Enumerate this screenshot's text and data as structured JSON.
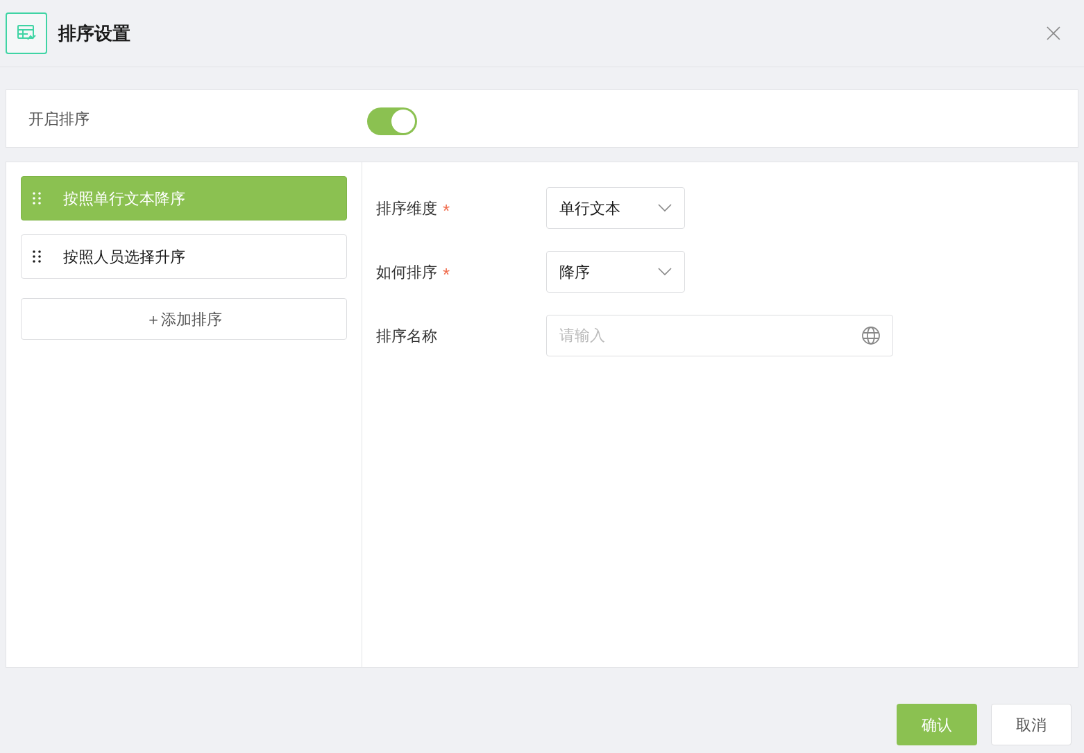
{
  "dialog": {
    "title": "排序设置"
  },
  "enable_sort": {
    "label": "开启排序",
    "on": true
  },
  "sort_rules": [
    {
      "label": "按照单行文本降序",
      "selected": true
    },
    {
      "label": "按照人员选择升序",
      "selected": false
    }
  ],
  "add_button": {
    "icon": "＋",
    "label": "添加排序"
  },
  "form": [
    {
      "kind": "select",
      "label": "排序维度",
      "required": true,
      "value": "单行文本"
    },
    {
      "kind": "select",
      "label": "如何排序",
      "required": true,
      "value": "降序"
    },
    {
      "kind": "input",
      "label": "排序名称",
      "required": false,
      "placeholder": "请输入"
    }
  ],
  "required_mark": "*",
  "buttons": [
    {
      "label": "确认",
      "primary": true
    },
    {
      "label": "取消",
      "primary": false
    }
  ]
}
